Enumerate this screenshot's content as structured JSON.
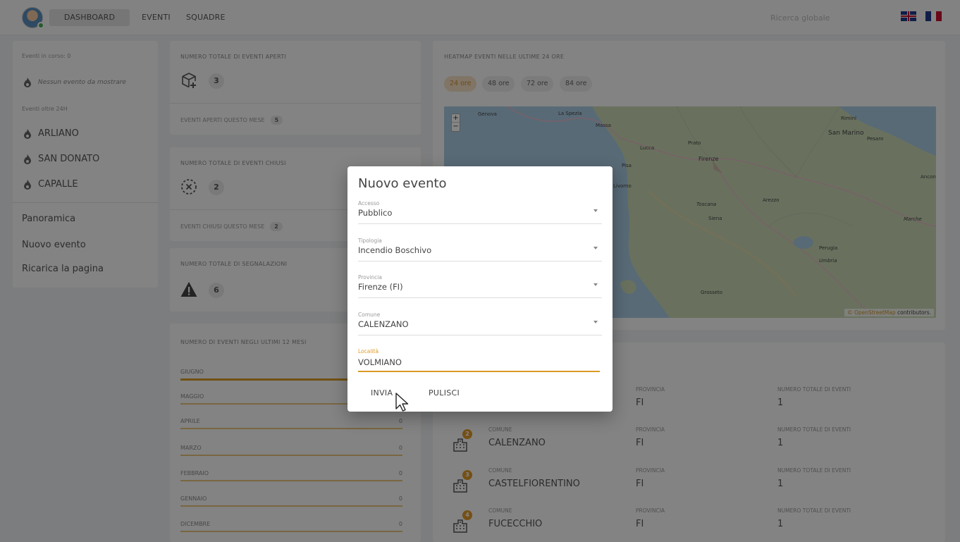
{
  "nav": {
    "dashboard": "DASHBOARD",
    "eventi": "EVENTI",
    "squadre": "SQUADRE",
    "search_placeholder": "Ricerca globale"
  },
  "sidebar": {
    "in_corso_label": "Eventi in corso: 0",
    "empty_message": "Nessun evento da mostrare",
    "oltre_label": "Eventi oltre 24H",
    "events": [
      "ARLIANO",
      "SAN DONATO",
      "CAPALLE"
    ],
    "links": [
      "Panoramica",
      "Nuovo evento",
      "Ricarica la pagina"
    ]
  },
  "stats": {
    "aperti": {
      "title": "NUMERO TOTALE DI EVENTI APERTI",
      "value": "3",
      "sub": "EVENTI APERTI QUESTO MESE",
      "sub_value": "5"
    },
    "chiusi": {
      "title": "NUMERO TOTALE DI EVENTI CHIUSI",
      "value": "2",
      "sub": "EVENTI CHIUSI QUESTO MESE",
      "sub_value": "2"
    },
    "segnalazioni": {
      "title": "NUMERO TOTALE DI SEGNALAZIONI",
      "value": "6"
    }
  },
  "months": {
    "title": "NUMERO DI EVENTI NEGLI ULTIMI 12 MESI",
    "rows": [
      {
        "name": "GIUGNO",
        "value": ""
      },
      {
        "name": "MAGGIO",
        "value": ""
      },
      {
        "name": "APRILE",
        "value": "0"
      },
      {
        "name": "MARZO",
        "value": "0"
      },
      {
        "name": "FEBBRAIO",
        "value": "0"
      },
      {
        "name": "GENNAIO",
        "value": "0"
      },
      {
        "name": "DICEMBRE",
        "value": "0"
      }
    ]
  },
  "heatmap": {
    "title": "HEATMAP EVENTI NELLE ULTIME 24 ORE",
    "tabs": [
      "24 ore",
      "48 ore",
      "72 ore",
      "84 ore"
    ],
    "attribution_link": "© OpenStreetMap",
    "attribution_text": " contributors.",
    "places": [
      "Genova",
      "La Spezia",
      "Massa",
      "Lucca",
      "Prato",
      "Firenze",
      "Pisa",
      "Livorno",
      "Toscana",
      "Siena",
      "Arezzo",
      "Perugia",
      "Umbria",
      "Grosseto",
      "Rimini",
      "San Marino",
      "Pesaro",
      "Marche",
      "Ancona"
    ]
  },
  "comuni": {
    "col_comune": "COMUNE",
    "col_provincia": "PROVINCIA",
    "col_totale": "NUMERO TOTALE DI EVENTI",
    "rows": [
      {
        "badge": "",
        "comune": "",
        "provincia": "FI",
        "totale": "1"
      },
      {
        "badge": "2",
        "comune": "CALENZANO",
        "provincia": "FI",
        "totale": "1"
      },
      {
        "badge": "3",
        "comune": "CASTELFIORENTINO",
        "provincia": "FI",
        "totale": "1"
      },
      {
        "badge": "4",
        "comune": "FUCECCHIO",
        "provincia": "FI",
        "totale": "1"
      }
    ]
  },
  "modal": {
    "title": "Nuovo evento",
    "fields": [
      {
        "label": "Accesso",
        "value": "Pubblico"
      },
      {
        "label": "Tipologia",
        "value": "Incendio Boschivo"
      },
      {
        "label": "Provincia",
        "value": "Firenze (FI)"
      },
      {
        "label": "Comune",
        "value": "CALENZANO"
      }
    ],
    "localita": {
      "label": "Località",
      "value": "VOLMIANO"
    },
    "submit": "INVIA",
    "clear": "PULISCI"
  },
  "colors": {
    "accent": "#d99a26",
    "badge": "#e09a2a",
    "overlay": "rgba(0,0,0,0.48)"
  }
}
